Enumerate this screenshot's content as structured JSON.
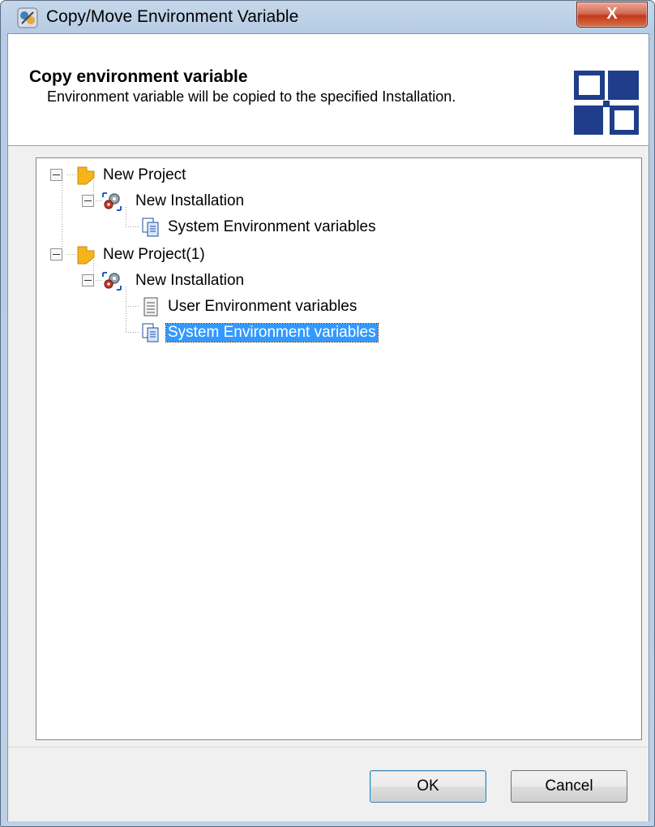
{
  "window": {
    "title": "Copy/Move Environment Variable",
    "close_label": "X"
  },
  "header": {
    "title": "Copy environment variable",
    "description": "Environment variable will be copied to the specified Installation.",
    "logo_icon": "squares-logo-icon"
  },
  "tree": {
    "nodes": [
      {
        "label": "New Project",
        "icon": "folder-icon",
        "expanded": true
      },
      {
        "label": "New Installation",
        "icon": "installation-gears-icon",
        "expanded": true
      },
      {
        "label": "System Environment variables",
        "icon": "system-env-vars-icon"
      },
      {
        "label": "New Project(1)",
        "icon": "folder-icon",
        "expanded": true
      },
      {
        "label": "New Installation",
        "icon": "installation-gears-icon",
        "expanded": true
      },
      {
        "label": "User Environment variables",
        "icon": "user-env-vars-icon"
      },
      {
        "label": "System Environment variables",
        "icon": "system-env-vars-icon",
        "selected": true
      }
    ]
  },
  "footer": {
    "ok_label": "OK",
    "cancel_label": "Cancel"
  },
  "colors": {
    "selection": "#3399ff",
    "logo_blue": "#1f3d8a",
    "folder": "#f5b41a"
  }
}
